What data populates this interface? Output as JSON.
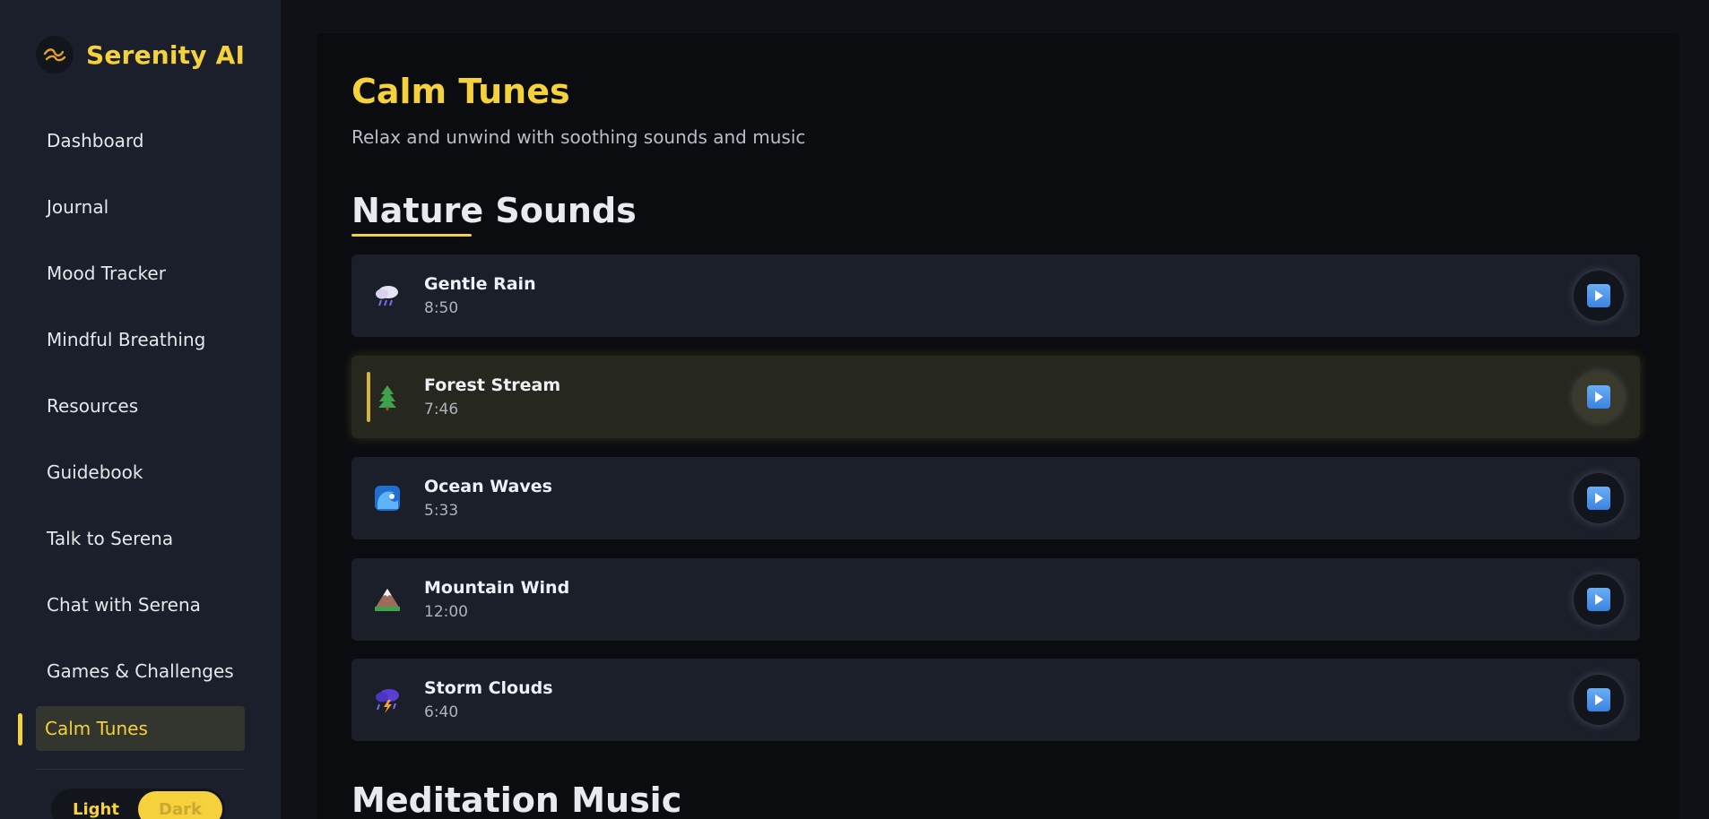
{
  "brand": {
    "name": "Serenity AI",
    "logo_icon": "wave-icon"
  },
  "sidebar": {
    "items": [
      {
        "label": "Dashboard"
      },
      {
        "label": "Journal"
      },
      {
        "label": "Mood Tracker"
      },
      {
        "label": "Mindful Breathing"
      },
      {
        "label": "Resources"
      },
      {
        "label": "Guidebook"
      },
      {
        "label": "Talk to Serena"
      },
      {
        "label": "Chat with Serena"
      },
      {
        "label": "Games & Challenges"
      },
      {
        "label": "Calm Tunes"
      }
    ],
    "active": "Calm Tunes"
  },
  "theme": {
    "light_label": "Light",
    "dark_label": "Dark",
    "selected": "Dark"
  },
  "page": {
    "title": "Calm Tunes",
    "subtitle": "Relax and unwind with soothing sounds and music"
  },
  "sections": [
    {
      "title": "Nature Sounds",
      "tracks": [
        {
          "name": "Gentle Rain",
          "duration": "8:50",
          "icon": "rain-cloud-icon",
          "playing": false
        },
        {
          "name": "Forest Stream",
          "duration": "7:46",
          "icon": "tree-icon",
          "playing": true
        },
        {
          "name": "Ocean Waves",
          "duration": "5:33",
          "icon": "wave-icon",
          "playing": false
        },
        {
          "name": "Mountain Wind",
          "duration": "12:00",
          "icon": "mountain-icon",
          "playing": false
        },
        {
          "name": "Storm Clouds",
          "duration": "6:40",
          "icon": "storm-cloud-icon",
          "playing": false
        }
      ]
    },
    {
      "title": "Meditation Music"
    }
  ],
  "colors": {
    "accent": "#f5d13b",
    "sidebar_bg": "#1a1f2b",
    "card_bg": "#1b1f2a",
    "play_blue": "#3b82e0"
  }
}
